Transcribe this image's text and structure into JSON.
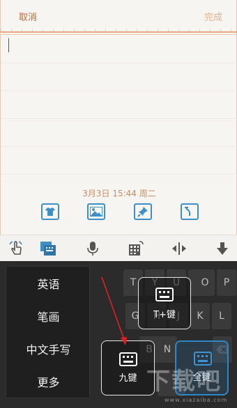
{
  "header": {
    "cancel_label": "取消",
    "done_label": "完成"
  },
  "note": {
    "datetime": "3月3日 15:44 周二"
  },
  "note_tools": [
    "shirt-icon",
    "image-icon",
    "pin-icon",
    "clock-icon"
  ],
  "toolbar": [
    "handwriting-touch-icon",
    "keyboard-switch-icon",
    "microphone-icon",
    "numpad-icon",
    "cursor-move-icon",
    "hide-keyboard-icon"
  ],
  "language_menu": {
    "items": [
      "英语",
      "笔画",
      "中文手写",
      "更多"
    ]
  },
  "keyboard_options": {
    "t9_plus": "T+键",
    "nine_key": "九键",
    "full_key": "全键"
  },
  "keyboard_keys": {
    "row1": [
      "T",
      "Y",
      "U",
      "I",
      "O",
      "P"
    ],
    "row2": [
      "G",
      "H",
      "J",
      "K",
      "L"
    ],
    "row3": [
      "B",
      "N",
      "M"
    ]
  },
  "watermark": {
    "logo": "下载吧",
    "url": "www.xiazaiba.com"
  },
  "colors": {
    "accent_orange": "#c06a3a",
    "accent_blue": "#3d8fc7",
    "keyboard_bg": "#2b2b2b",
    "arrow": "#e02020"
  }
}
